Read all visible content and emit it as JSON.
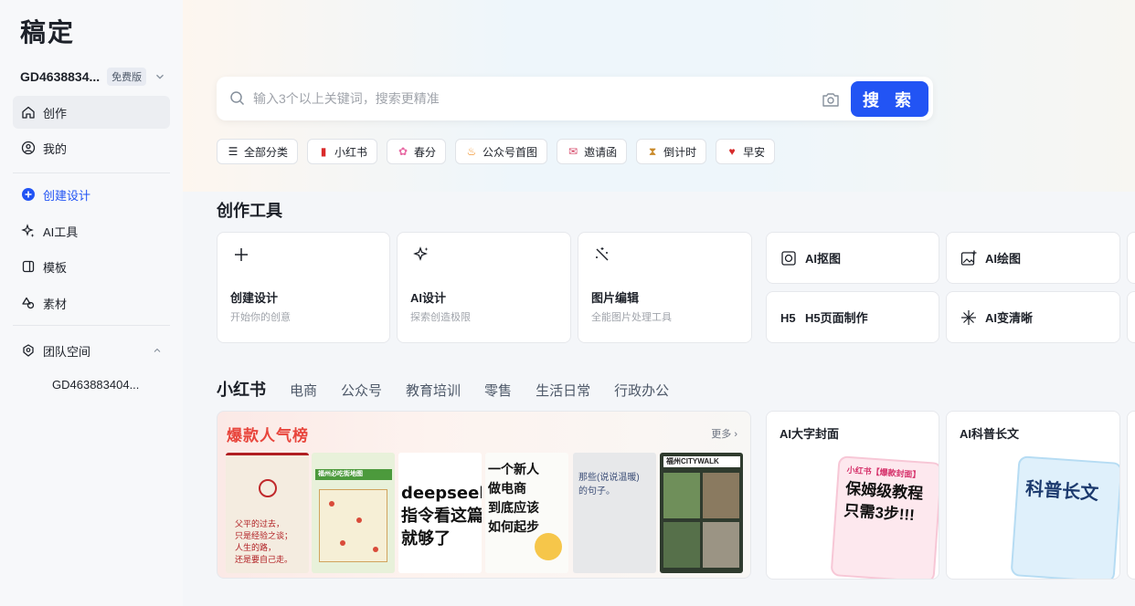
{
  "app": {
    "logo": "稿定"
  },
  "account": {
    "name": "GD4638834...",
    "plan_badge": "免费版"
  },
  "sidebar": {
    "items": [
      {
        "label": "创作"
      },
      {
        "label": "我的"
      },
      {
        "label": "创建设计"
      },
      {
        "label": "AI工具"
      },
      {
        "label": "模板"
      },
      {
        "label": "素材"
      },
      {
        "label": "团队空间"
      }
    ],
    "team_sub_item": "GD463883404..."
  },
  "search": {
    "placeholder": "输入3个以上关键词，搜索更精准",
    "button_label": "搜 索"
  },
  "chips": [
    {
      "label": "全部分类",
      "icon": "menu-icon"
    },
    {
      "label": "小红书",
      "icon": "red-book-icon"
    },
    {
      "label": "春分",
      "icon": "flower-icon"
    },
    {
      "label": "公众号首图",
      "icon": "flame-icon"
    },
    {
      "label": "邀请函",
      "icon": "envelope-icon"
    },
    {
      "label": "倒计时",
      "icon": "hourglass-icon"
    },
    {
      "label": "早安",
      "icon": "heart-pin-icon"
    }
  ],
  "creation_tools": {
    "title": "创作工具",
    "large": [
      {
        "name": "创建设计",
        "desc": "开始你的创意",
        "icon": "plus-icon"
      },
      {
        "name": "AI设计",
        "desc": "探索创造极限",
        "icon": "sparkle-icon"
      },
      {
        "name": "图片编辑",
        "desc": "全能图片处理工具",
        "icon": "magic-wand-icon"
      }
    ],
    "small": [
      {
        "name": "AI抠图",
        "icon": "cutout-icon"
      },
      {
        "name": "AI绘图",
        "icon": "image-plus-icon"
      },
      {
        "name": "H5页面制作",
        "icon": "h5-icon"
      },
      {
        "name": "AI变清晰",
        "icon": "sparkle-icon"
      }
    ]
  },
  "categories": {
    "tabs": [
      "小红书",
      "电商",
      "公众号",
      "教育培训",
      "零售",
      "生活日常",
      "行政办公"
    ],
    "active": "小红书"
  },
  "hot": {
    "title": "爆款人气榜",
    "more_label": "更多",
    "thumbs": {
      "t1_text": "父平的过去，\n只是经验之谈；\n人生的路，\n还是要自己走。",
      "t2_band": "福州必吃街地图",
      "t3_text": "deepseek\n指令看这篇\n就够了",
      "t4_text": "一个新人\n做电商\n到底应该\n如何起步",
      "t5_text": "那些(说说温暖)\n的句子。",
      "t6_band": "福州CITYWALK"
    }
  },
  "promos": [
    {
      "title": "AI大字封面",
      "art_text": "保姆级教程\n只需3步!!!",
      "art_tag": "小红书【爆款封面】"
    },
    {
      "title": "AI科普长文",
      "art_text": "科普长文",
      "art_tag": ""
    }
  ],
  "colors": {
    "accent": "#2254f4",
    "hot_red": "#e8453c"
  }
}
